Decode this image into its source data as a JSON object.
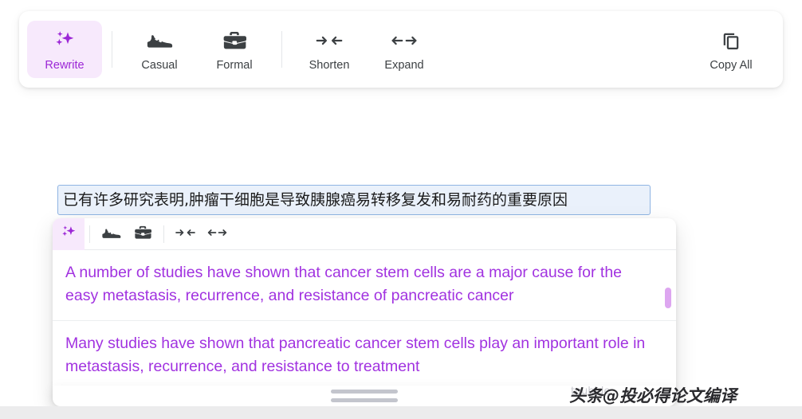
{
  "toolbar": {
    "items": [
      {
        "label": "Rewrite",
        "icon": "sparkle-icon",
        "active": true
      },
      {
        "label": "Casual",
        "icon": "sneaker-icon",
        "active": false
      },
      {
        "label": "Formal",
        "icon": "briefcase-icon",
        "active": false
      },
      {
        "label": "Shorten",
        "icon": "shorten-arrows-icon",
        "active": false
      },
      {
        "label": "Expand",
        "icon": "expand-arrows-icon",
        "active": false
      }
    ],
    "copy_all": {
      "label": "Copy All",
      "icon": "copy-icon"
    }
  },
  "source": {
    "value": "已有许多研究表明,肿瘤干细胞是导致胰腺癌易转移复发和易耐药的重要原因"
  },
  "panel": {
    "mini_toolbar": [
      {
        "icon": "sparkle-icon",
        "name": "rewrite",
        "active": true
      },
      {
        "icon": "sneaker-icon",
        "name": "casual",
        "active": false
      },
      {
        "icon": "briefcase-icon",
        "name": "formal",
        "active": false
      },
      {
        "icon": "shorten-arrows-icon",
        "name": "shorten",
        "active": false
      },
      {
        "icon": "expand-arrows-icon",
        "name": "expand",
        "active": false
      }
    ],
    "suggestions": [
      "A number of studies have shown that cancer stem cells are a major cause for the easy metastasis, recurrence, and resistance of pancreatic cancer",
      "Many studies have shown that pancreatic cancer stem cells play an important role in metastasis, recurrence, and resistance to treatment"
    ]
  },
  "watermark": {
    "text": "头条@投必得论文编译",
    "ghost": "toubide"
  },
  "colors": {
    "accent": "#9c27d6",
    "suggestion_text": "#a132e0",
    "accent_soft_bg": "#f7e9fc",
    "icon": "#3c4043",
    "input_bg": "#eaf1fb",
    "input_border": "#8fb4e3",
    "scroll_thumb": "#dda6f0"
  }
}
